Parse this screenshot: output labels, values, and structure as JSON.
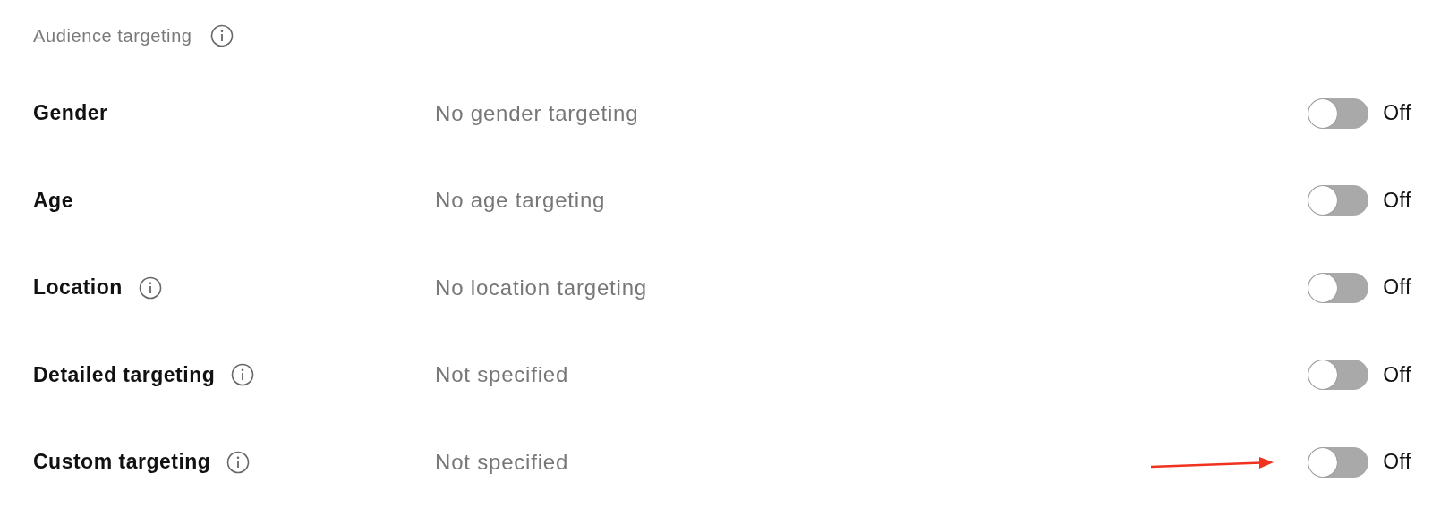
{
  "section": {
    "title": "Audience targeting",
    "info": true
  },
  "rows": [
    {
      "label": "Gender",
      "info": false,
      "value": "No gender targeting",
      "on": false,
      "state_label": "Off"
    },
    {
      "label": "Age",
      "info": false,
      "value": "No age targeting",
      "on": false,
      "state_label": "Off"
    },
    {
      "label": "Location",
      "info": true,
      "value": "No location targeting",
      "on": false,
      "state_label": "Off"
    },
    {
      "label": "Detailed targeting",
      "info": true,
      "value": "Not specified",
      "on": false,
      "state_label": "Off"
    },
    {
      "label": "Custom targeting",
      "info": true,
      "value": "Not specified",
      "on": false,
      "state_label": "Off"
    }
  ]
}
